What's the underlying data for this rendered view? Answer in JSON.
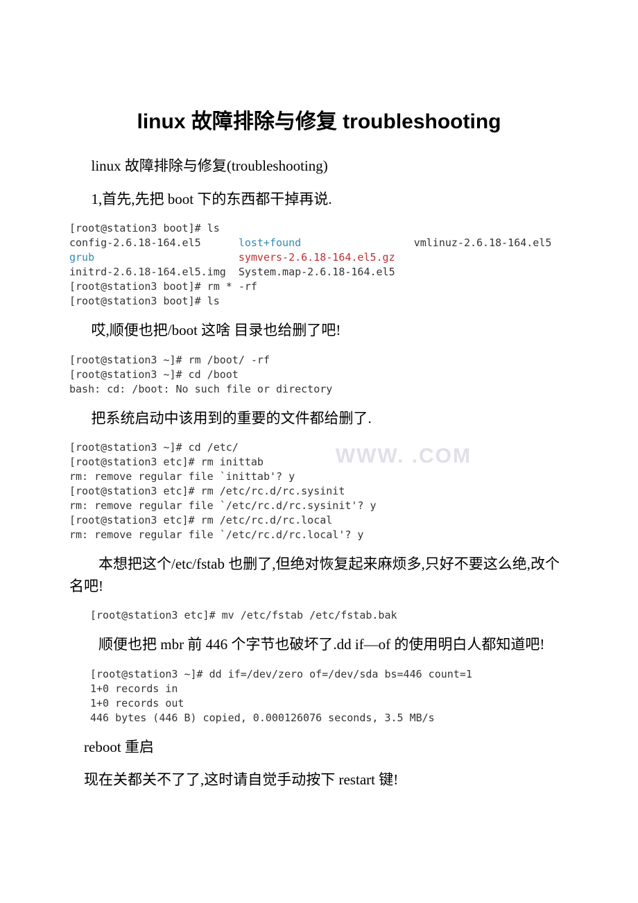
{
  "title": "linux 故障排除与修复 troubleshooting",
  "intro": "linux 故障排除与修复(troubleshooting)",
  "s1": "1,首先,先把 boot 下的东西都干掉再说.",
  "term1": {
    "l1": "[root@station3 boot]# ls",
    "l2a": "config-2.6.18-164.el5",
    "l2b": "lost+found",
    "l2c": "vmlinuz-2.6.18-164.el5",
    "l3a": "grub",
    "l3b": "symvers-2.6.18-164.el5.gz",
    "l4": "initrd-2.6.18-164.el5.img  System.map-2.6.18-164.el5",
    "l5": "[root@station3 boot]# rm * -rf",
    "l6": "[root@station3 boot]# ls"
  },
  "s2": "哎,顺便也把/boot 这啥 目录也给删了吧!",
  "term2": {
    "l1": "[root@station3 ~]# rm /boot/ -rf",
    "l2": "[root@station3 ~]# cd /boot",
    "l3": "bash: cd: /boot: No such file or directory"
  },
  "s3": "把系统启动中该用到的重要的文件都给删了.",
  "term3": {
    "l1": "[root@station3 ~]# cd /etc/",
    "l2": "[root@station3 etc]# rm inittab",
    "l3": "rm: remove regular file `inittab'? y",
    "l4": "[root@station3 etc]# rm /etc/rc.d/rc.sysinit",
    "l5": "rm: remove regular file `/etc/rc.d/rc.sysinit'? y",
    "l6": "[root@station3 etc]# rm /etc/rc.d/rc.local",
    "l7": "rm: remove regular file `/etc/rc.d/rc.local'? y"
  },
  "s4": "本想把这个/etc/fstab 也删了,但绝对恢复起来麻烦多,只好不要这么绝,改个名吧!",
  "term4": {
    "l1": "[root@station3 etc]# mv /etc/fstab /etc/fstab.bak"
  },
  "s5": "顺便也把 mbr 前 446 个字节也破坏了.dd if—of 的使用明白人都知道吧!",
  "term5": {
    "l1": "[root@station3 ~]# dd if=/dev/zero of=/dev/sda bs=446 count=1",
    "l2": "1+0 records in",
    "l3": "1+0 records out",
    "l4": "446 bytes (446 B) copied, 0.000126076 seconds, 3.5 MB/s"
  },
  "s6": "reboot 重启",
  "s7": "现在关都关不了了,这时请自觉手动按下 restart 键!",
  "watermark": "WWW.      .COM"
}
